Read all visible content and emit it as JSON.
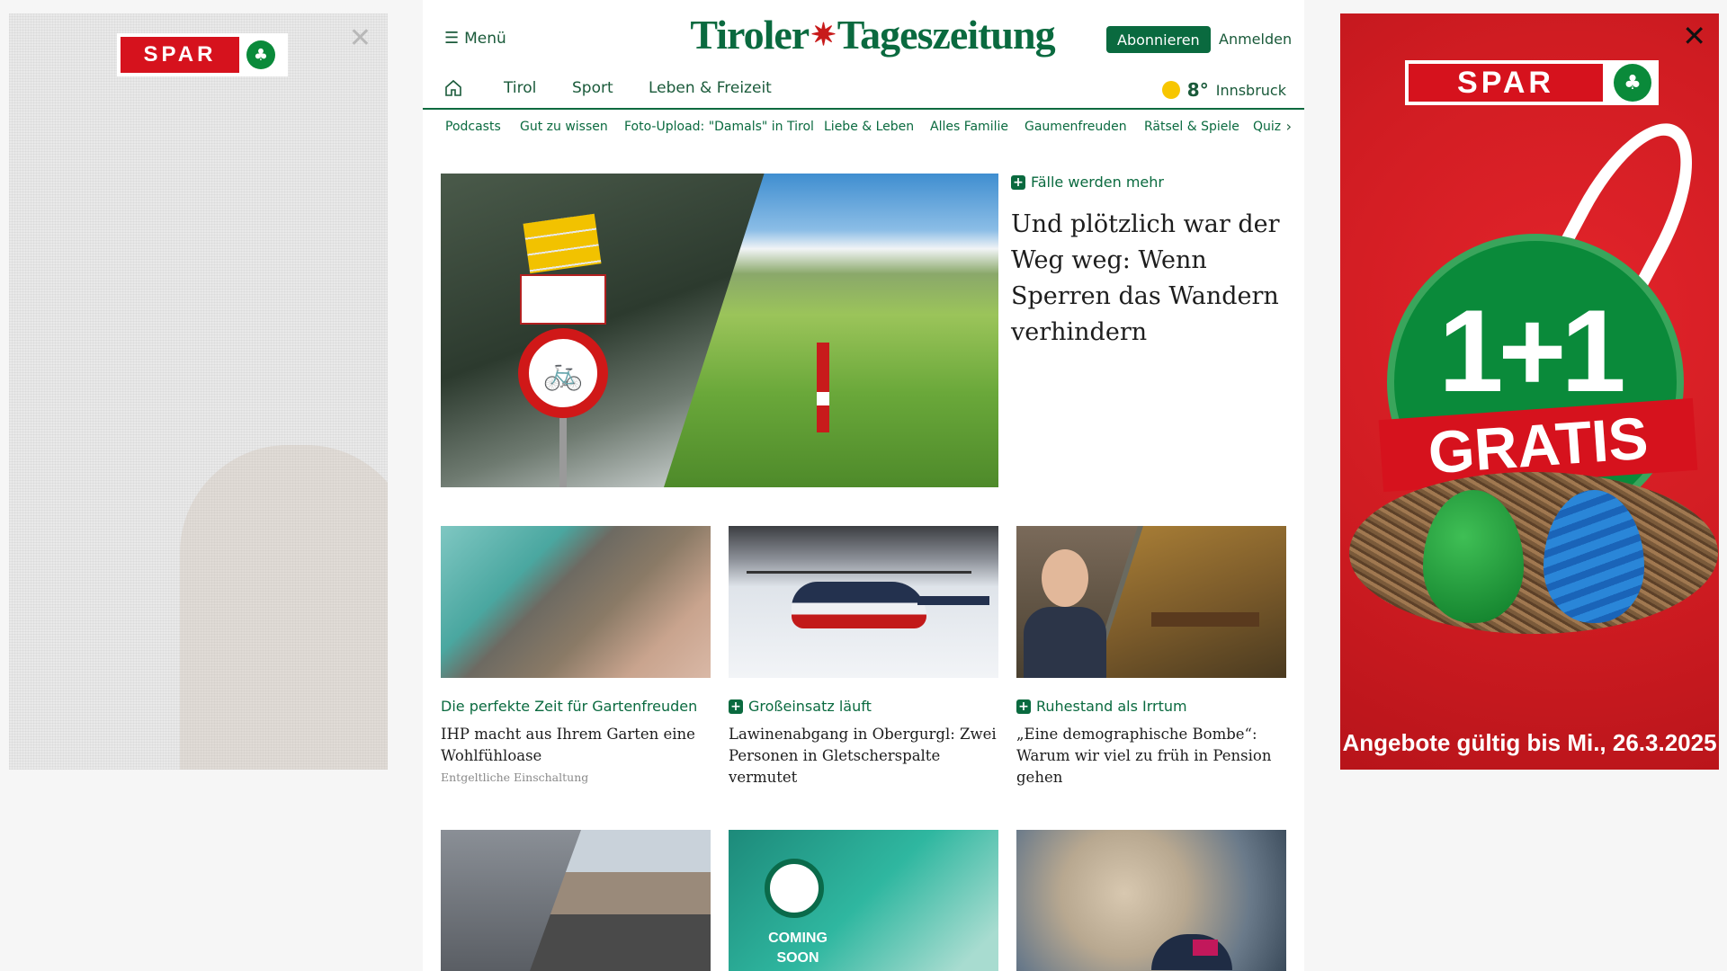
{
  "ads": {
    "left": {
      "brand": "SPAR"
    },
    "right": {
      "brand": "SPAR",
      "promo_number": "1+1",
      "promo_word": "GRATIS",
      "validity": "Angebote gültig bis Mi., 26.3.2025",
      "colors": {
        "background": "#d6121d",
        "badge": "#0a8a3a"
      }
    }
  },
  "header": {
    "menu_label": "Menü",
    "logo_text_left": "Tiroler",
    "logo_text_right": "Tageszeitung",
    "subscribe_label": "Abonnieren",
    "login_label": "Anmelden",
    "brand_color": "#0a6a3f"
  },
  "nav": {
    "items": [
      "Tirol",
      "Sport",
      "Leben & Freizeit"
    ],
    "weather": {
      "temperature": "8°",
      "city": "Innsbruck"
    }
  },
  "subnav": {
    "items": [
      "Podcasts",
      "Gut zu wissen",
      "Foto-Upload: \"Damals\" in Tirol",
      "Liebe & Leben",
      "Alles Familie",
      "Gaumenfreuden",
      "Rätsel & Spiele",
      "Quiz"
    ]
  },
  "hero": {
    "kicker": "Fälle werden mehr",
    "title": "Und plötzlich war der Weg weg: Wenn Sperren das Wandern verhindern",
    "premium": true
  },
  "cards": [
    {
      "kicker": "Die perfekte Zeit für Gartenfreuden",
      "title": "IHP macht aus Ihrem Garten eine Wohlfühloase",
      "sponsor": "Entgeltliche Einschaltung",
      "premium": false
    },
    {
      "kicker": "Großeinsatz läuft",
      "title": "Lawinenabgang in Obergurgl: Zwei Personen in Gletscherspalte vermutet",
      "premium": true
    },
    {
      "kicker": "Ruhestand als Irrtum",
      "title": "„Eine demographische Bombe“: Warum wir viel zu früh in Pension gehen",
      "premium": true
    }
  ],
  "teaser_images": {
    "starbucks_text": "COMING SOON"
  }
}
